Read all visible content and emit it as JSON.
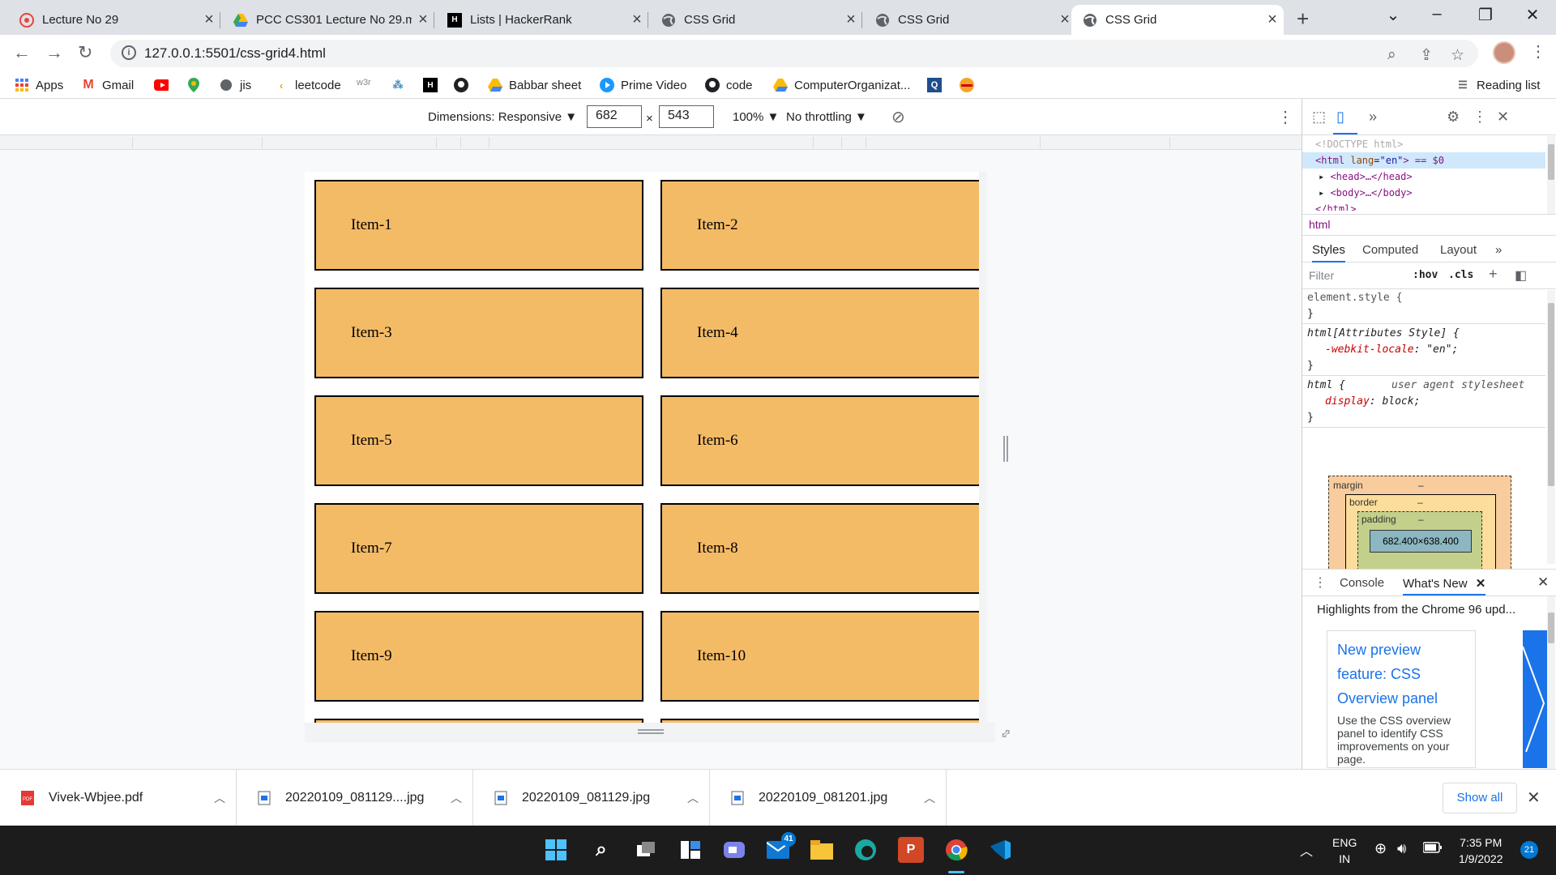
{
  "tabs": [
    {
      "title": "Lecture No 29",
      "icon": "graduation-icon",
      "color": "#e8453c"
    },
    {
      "title": "PCC CS301 Lecture No 29.m",
      "icon": "google-drive-icon",
      "color": "#fbbc04"
    },
    {
      "title": "Lists | HackerRank",
      "icon": "hackerrank-icon",
      "color": "#1ba94c"
    },
    {
      "title": "CSS Grid",
      "icon": "globe-icon",
      "color": "#5f6368"
    },
    {
      "title": "CSS Grid",
      "icon": "globe-icon",
      "color": "#5f6368"
    },
    {
      "title": "CSS Grid",
      "icon": "globe-icon",
      "color": "#5f6368",
      "active": true
    }
  ],
  "address_bar": {
    "url": "127.0.0.1:5501/css-grid4.html"
  },
  "bookmarks": [
    {
      "label": "Apps",
      "icon": "apps-grid-icon"
    },
    {
      "label": "Gmail",
      "icon": "gmail-icon"
    },
    {
      "label": "",
      "icon": "youtube-icon"
    },
    {
      "label": "",
      "icon": "maps-icon"
    },
    {
      "label": "jis",
      "icon": "globe-icon"
    },
    {
      "label": "leetcode",
      "icon": "leetcode-icon"
    },
    {
      "label": "w3r",
      "icon": "w3resource-icon"
    },
    {
      "label": "",
      "icon": "network-icon"
    },
    {
      "label": "",
      "icon": "hackerrank-icon"
    },
    {
      "label": "",
      "icon": "github-icon"
    },
    {
      "label": "Babbar sheet",
      "icon": "google-drive-icon"
    },
    {
      "label": "Prime Video",
      "icon": "prime-video-icon"
    },
    {
      "label": "code",
      "icon": "github-icon"
    },
    {
      "label": "ComputerOrganizat...",
      "icon": "google-drive-icon"
    },
    {
      "label": "",
      "icon": "search-page-icon"
    },
    {
      "label": "",
      "icon": "burger-icon"
    }
  ],
  "reading_list": "Reading list",
  "device_toolbar": {
    "dimensions": "Dimensions: Responsive ▼",
    "width": "682",
    "height": "543",
    "times": "×",
    "zoom": "100% ▼",
    "throttling": "No throttling ▼"
  },
  "grid_items": [
    "Item-1",
    "Item-2",
    "Item-3",
    "Item-4",
    "Item-5",
    "Item-6",
    "Item-7",
    "Item-8",
    "Item-9",
    "Item-10"
  ],
  "devtools": {
    "elements": {
      "doctype": "<!DOCTYPE html>",
      "html_open": "<html",
      "lang_attr": "lang",
      "lang_val": "\"en\"",
      "html_suffix": "> == $0",
      "head": "<head>…</head>",
      "body": "<body>…</body>",
      "html_close": "</html>"
    },
    "breadcrumb": "html",
    "subtabs": [
      "Styles",
      "Computed",
      "Layout",
      "»"
    ],
    "filter_placeholder": "Filter",
    "hov": ":hov",
    "cls": ".cls",
    "rules": {
      "element_style": "element.style {",
      "close": "}",
      "attr_selector": "html[Attributes Style] {",
      "locale_prop": "-webkit-locale",
      "locale_val": ": \"en\";",
      "html_selector": "html {",
      "ua": "user agent stylesheet",
      "display_prop": "display",
      "display_val": ": block;"
    },
    "box_model": {
      "margin": "margin",
      "border": "border",
      "padding": "padding",
      "dash": "–",
      "content": "682.400×638.400"
    },
    "drawer_tabs": {
      "console": "Console",
      "whats_new": "What's New"
    },
    "whats_new": {
      "headline": "Highlights from the Chrome 96 upd...",
      "card_title": [
        "New preview",
        "feature: CSS",
        "Overview panel"
      ],
      "card_desc": "Use the CSS overview panel to identify CSS improvements on your page."
    }
  },
  "downloads": [
    {
      "name": "Vivek-Wbjee.pdf",
      "icon": "pdf-icon"
    },
    {
      "name": "20220109_081129....jpg",
      "icon": "image-file-icon"
    },
    {
      "name": "20220109_081129.jpg",
      "icon": "image-file-icon"
    },
    {
      "name": "20220109_081201.jpg",
      "icon": "image-file-icon"
    }
  ],
  "show_all": "Show all",
  "taskbar": {
    "mail_badge": "41",
    "lang": "ENG",
    "region": "IN",
    "time": "7:35 PM",
    "date": "1/9/2022",
    "notifications": "21"
  },
  "colors": {
    "item_fill": "#f4bb67",
    "accent": "#1a73e8",
    "tab_bg": "#dee1e6"
  }
}
